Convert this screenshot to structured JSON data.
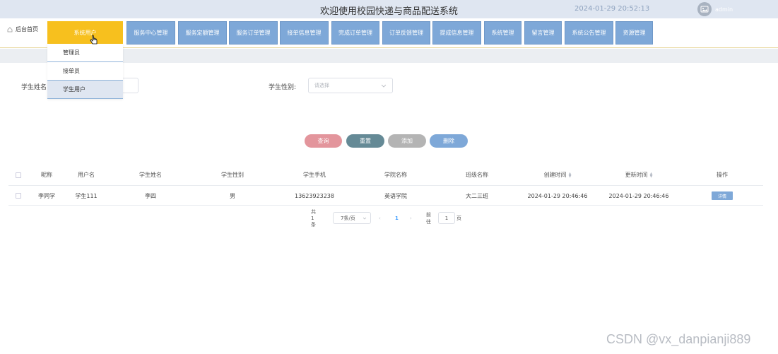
{
  "header": {
    "title": "欢迎使用校园快递与商品配送系统",
    "datetime": "2024-01-29 20:52:13",
    "username": "admin"
  },
  "nav": {
    "home": "后台首页",
    "items": [
      {
        "label": "系统用户",
        "active": true
      },
      {
        "label": "服务中心管理"
      },
      {
        "label": "服务定额管理"
      },
      {
        "label": "服务订单管理"
      },
      {
        "label": "接单信息管理"
      },
      {
        "label": "完成订单管理"
      },
      {
        "label": "订单反馈管理"
      },
      {
        "label": "提成信息管理"
      },
      {
        "label": "系统管理"
      },
      {
        "label": "留言管理"
      },
      {
        "label": "系统公告管理"
      },
      {
        "label": "资源管理"
      }
    ],
    "dropdown": [
      "管理员",
      "接单员",
      "学生用户"
    ]
  },
  "search": {
    "name_label": "学生姓名",
    "gender_label": "学生性别:",
    "gender_placeholder": "请选择"
  },
  "actions": {
    "query": "查询",
    "reset": "重置",
    "add": "添加",
    "delete": "删除"
  },
  "table": {
    "headers": [
      "昵称",
      "用户名",
      "学生姓名",
      "学生性别",
      "学生手机",
      "学院名称",
      "班级名称",
      "创建时间",
      "更新时间",
      "操作"
    ],
    "rows": [
      [
        "李同学",
        "学生111",
        "李四",
        "男",
        "13623923238",
        "英语学院",
        "大二三班",
        "2024-01-29 20:46:46",
        "2024-01-29 20:46:46",
        "详情"
      ]
    ]
  },
  "pagination": {
    "total": "共 1 条",
    "page_size": "7条/页",
    "current_page": "1",
    "goto_label": "前往",
    "goto_value": "1",
    "page_unit": "页",
    "prev": "‹",
    "next": "›"
  },
  "watermark": "CSDN @vx_danpianji889",
  "colors": {
    "header_bg": "#dfe6f1",
    "nav_button": "#7ea8d8",
    "nav_active": "#f7c01e",
    "query": "#e3959c",
    "reset": "#658a96",
    "add": "#b4b4b4",
    "delete": "#7ea8d8"
  }
}
